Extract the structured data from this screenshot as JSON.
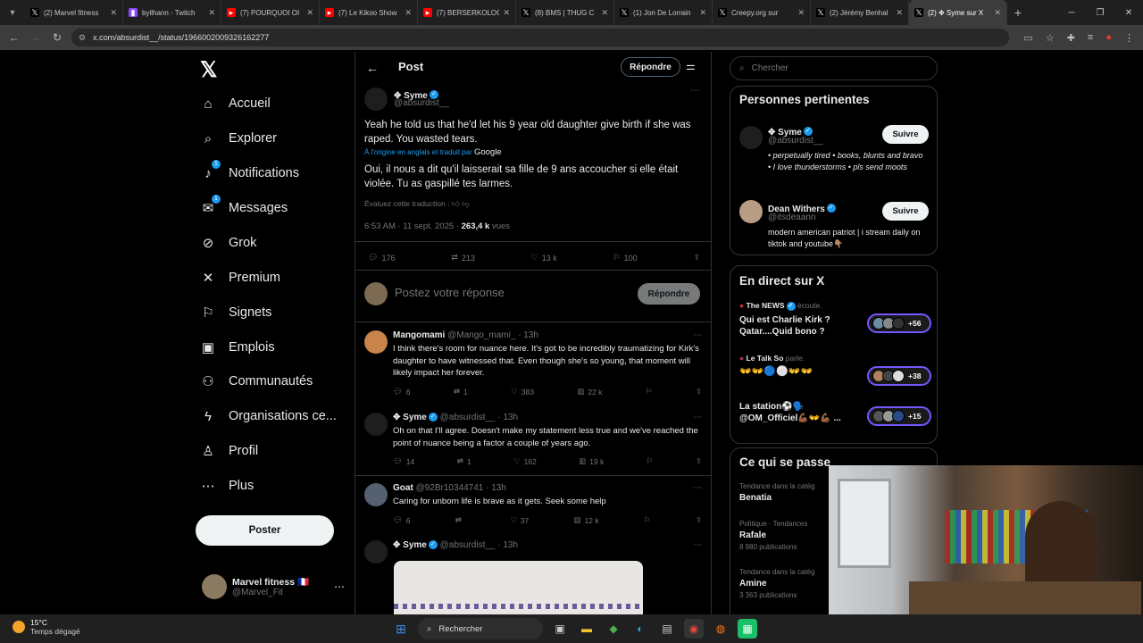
{
  "browser": {
    "tabs": [
      {
        "title": "(2) Marvel fitness",
        "icon": "x-icon",
        "color": "#000000"
      },
      {
        "title": "byilhann - Twitch",
        "icon": "twitch-icon",
        "color": "#9146ff"
      },
      {
        "title": "(7) POURQUOI OI",
        "icon": "youtube-icon",
        "color": "#ff0000"
      },
      {
        "title": "(7) Le Kikoo Show",
        "icon": "youtube-icon",
        "color": "#ff0000"
      },
      {
        "title": "(7) BERSERKOLOG",
        "icon": "youtube-icon",
        "color": "#ff0000"
      },
      {
        "title": "(8) BMS | THUG C",
        "icon": "x-icon",
        "color": "#000000"
      },
      {
        "title": "(1) Jon De Lorrain",
        "icon": "x-icon",
        "color": "#000000"
      },
      {
        "title": "Creepy.org sur",
        "icon": "x-icon",
        "color": "#000000"
      },
      {
        "title": "(2) Jérémy Benhal",
        "icon": "x-icon",
        "color": "#000000"
      },
      {
        "title": "(2) ✥ Syme sur X",
        "icon": "x-icon",
        "color": "#000000"
      }
    ],
    "url": "x.com/absurdist__/status/1966002009326162277"
  },
  "nav": {
    "items": [
      {
        "label": "Accueil",
        "icon": "⌂",
        "name": "home",
        "badge": ""
      },
      {
        "label": "Explorer",
        "icon": "⌕",
        "name": "explore",
        "badge": ""
      },
      {
        "label": "Notifications",
        "icon": "🔔",
        "name": "notifications",
        "badge": "1"
      },
      {
        "label": "Messages",
        "icon": "✉",
        "name": "messages",
        "badge": "1"
      },
      {
        "label": "Grok",
        "icon": "⊘",
        "name": "grok",
        "badge": ""
      },
      {
        "label": "Premium",
        "icon": "𝕏",
        "name": "premium",
        "badge": ""
      },
      {
        "label": "Signets",
        "icon": "⚐",
        "name": "bookmarks",
        "badge": ""
      },
      {
        "label": "Emplois",
        "icon": "▣",
        "name": "jobs",
        "badge": ""
      },
      {
        "label": "Communautés",
        "icon": "⚇",
        "name": "communities",
        "badge": ""
      },
      {
        "label": "Organisations ce...",
        "icon": "ϟ",
        "name": "organisations",
        "badge": ""
      },
      {
        "label": "Profil",
        "icon": "♙",
        "name": "profile",
        "badge": ""
      },
      {
        "label": "Plus",
        "icon": "⋯",
        "name": "more",
        "badge": ""
      }
    ],
    "post_label": "Poster",
    "me": {
      "name": "Marvel fitness 🇫🇷",
      "handle": "@Marvel_Fit"
    }
  },
  "post": {
    "header_title": "Post",
    "reply_top_label": "Répondre",
    "author": "✥ Syme",
    "handle": "@absurdist__",
    "text": "Yeah he told us that he'd let his 9 year old daughter give birth if she was raped. You wasted tears.",
    "translated_note": "À l'origine en anglais et traduit par",
    "translated_by": "Google",
    "translation": "Oui, il nous a dit qu'il laisserait sa fille de 9 ans accoucher si elle était violée. Tu as gaspillé tes larmes.",
    "rate_translation": "Évaluez cette traduction :",
    "time": "6:53 AM · 11 sept. 2025 ·",
    "views_count": "263,4 k",
    "views_label": "vues",
    "stats": {
      "replies": "176",
      "reposts": "213",
      "likes": "13 k",
      "bookmarks": "100"
    }
  },
  "composer": {
    "placeholder": "Postez votre réponse",
    "button": "Répondre"
  },
  "replies": [
    {
      "name": "Mangomami",
      "handle": "@Mango_mami_",
      "time": "· 13h",
      "text": "I think there's room for nuance here. It's got to be incredibly traumatizing for Kirk's daughter to have witnessed that. Even though she's so young, that moment will likely impact her forever.",
      "stats": {
        "replies": "6",
        "reposts": "1",
        "likes": "383",
        "views": "22 k"
      }
    },
    {
      "name": "✥ Syme",
      "handle": "@absurdist__",
      "time": "· 13h",
      "text": "Oh on that I'll agree. Doesn't make my statement less true and we've reached the point of nuance being a factor a couple of years ago.",
      "stats": {
        "replies": "14",
        "reposts": "1",
        "likes": "162",
        "views": "19 k"
      }
    },
    {
      "name": "Goat",
      "handle": "@92Br10344741",
      "time": "· 13h",
      "text": "Caring for unborn life is brave as it gets. Seek some help",
      "stats": {
        "replies": "6",
        "reposts": "",
        "likes": "37",
        "views": "12 k"
      }
    },
    {
      "name": "✥ Syme",
      "handle": "@absurdist__",
      "time": "· 13h",
      "text": "",
      "stats": {}
    }
  ],
  "sidebar": {
    "search_placeholder": "Chercher",
    "relevant_title": "Personnes pertinentes",
    "people": [
      {
        "name": "✥ Syme",
        "handle": "@absurdist__",
        "follow": "Suivre",
        "bio": "• perpetually tired • books, blunts and bravo • I love thunderstorms • pls send moots"
      },
      {
        "name": "Dean Withers",
        "handle": "@itsdeaann",
        "follow": "Suivre",
        "bio": "modern american patriot | i stream daily on tiktok and youtube👇🏽"
      }
    ],
    "live_title": "En direct sur X",
    "live": [
      {
        "host": "The NEWS",
        "verb": "écoute.",
        "title": "Qui est Charlie Kirk ? Qatar....Quid bono ?",
        "count": "+56"
      },
      {
        "host": "Le Talk So",
        "verb": "parle.",
        "title": "👐👐🔵⚪👐👐",
        "count": "+38"
      },
      {
        "host": "",
        "verb": "",
        "title": "La station⚽🗣️ @OM_Officiel💪🏾👐💪🏾 ...",
        "count": "+15"
      }
    ],
    "trends_title": "Ce qui se passe",
    "trends": [
      {
        "cat": "Tendance dans la catég",
        "name": "Benatia",
        "posts": ""
      },
      {
        "cat": "Politique · Tendances",
        "name": "Rafale",
        "posts": "8 980 publications"
      },
      {
        "cat": "Tendance dans la catég",
        "name": "Amine",
        "posts": "3 363 publications"
      }
    ]
  },
  "taskbar": {
    "temp": "15°C",
    "weather": "Temps dégagé",
    "search": "Rechercher"
  }
}
